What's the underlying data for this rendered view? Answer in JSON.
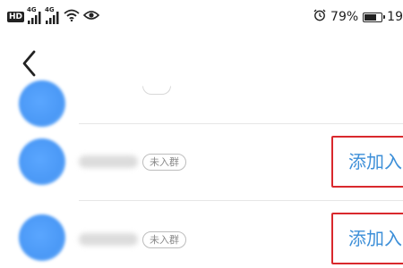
{
  "status_bar": {
    "hd_label": "HD",
    "sim1_network": "4G",
    "sim2_network": "4G",
    "battery_percent_label": "79%",
    "battery_level": 0.79,
    "time_partial": "19"
  },
  "nav": {
    "back_icon": "chevron-left-icon"
  },
  "colors": {
    "accent": "#3d8fd8",
    "highlight_border": "#d9282d",
    "avatar": "#4b99f6"
  },
  "contacts": [
    {
      "tag": "未入群",
      "action": "添加入"
    },
    {
      "tag": "未入群",
      "action": "添加入"
    }
  ]
}
